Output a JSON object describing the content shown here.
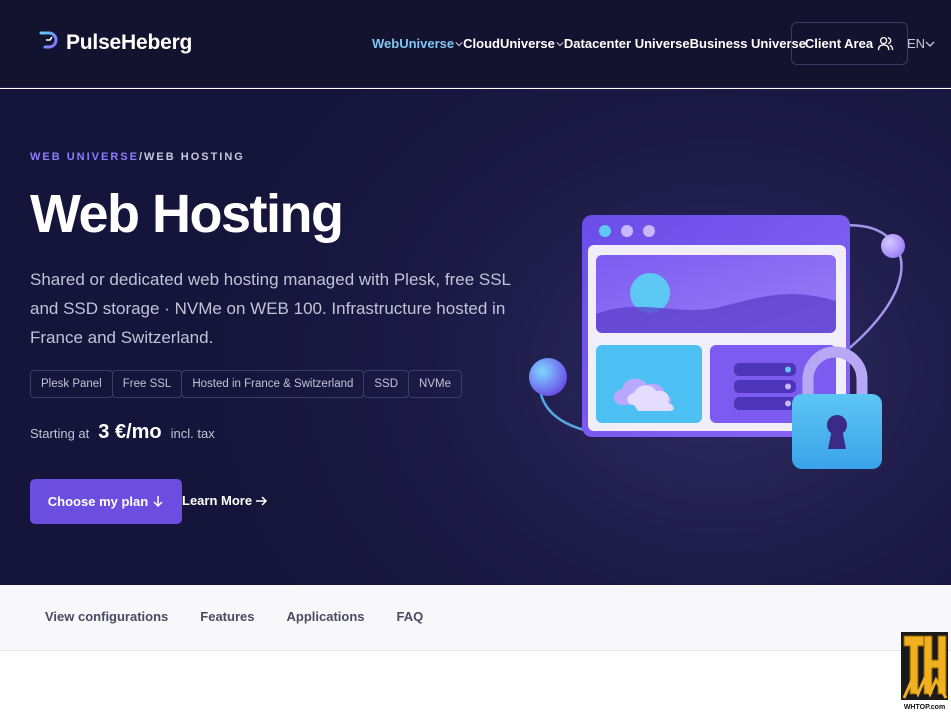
{
  "brand": {
    "name": "PulseHeberg"
  },
  "nav": {
    "items": [
      {
        "label": "WebUniverse",
        "active": true,
        "dropdown": true
      },
      {
        "label": "CloudUniverse",
        "active": false,
        "dropdown": true
      },
      {
        "label": "Datacenter Universe",
        "active": false,
        "dropdown": false
      },
      {
        "label": "Business Universe",
        "active": false,
        "dropdown": false
      }
    ],
    "client_area": "Client Area",
    "language": "EN"
  },
  "hero": {
    "breadcrumb": {
      "parent": "WEB UNIVERSE",
      "separator": "/",
      "current": "WEB HOSTING"
    },
    "title": "Web Hosting",
    "description": "Shared or dedicated web hosting managed with Plesk, free SSL and SSD storage · NVMe on WEB 100. Infrastructure hosted in France and Switzerland.",
    "tags": [
      "Plesk Panel",
      "Free SSL",
      "Hosted in France & Switzerland",
      "SSD",
      "NVMe"
    ],
    "price": {
      "prefix": "Starting at",
      "amount": "3 €/mo",
      "suffix": "incl. tax"
    },
    "cta_primary": "Choose my plan",
    "cta_secondary": "Learn More"
  },
  "subnav": {
    "items": [
      "View configurations",
      "Features",
      "Applications",
      "FAQ"
    ]
  },
  "colors": {
    "header_bg": "#14132f",
    "accent": "#6b4ee0",
    "nav_active": "#7fc6f2",
    "breadcrumb_link": "#8c7dff"
  }
}
